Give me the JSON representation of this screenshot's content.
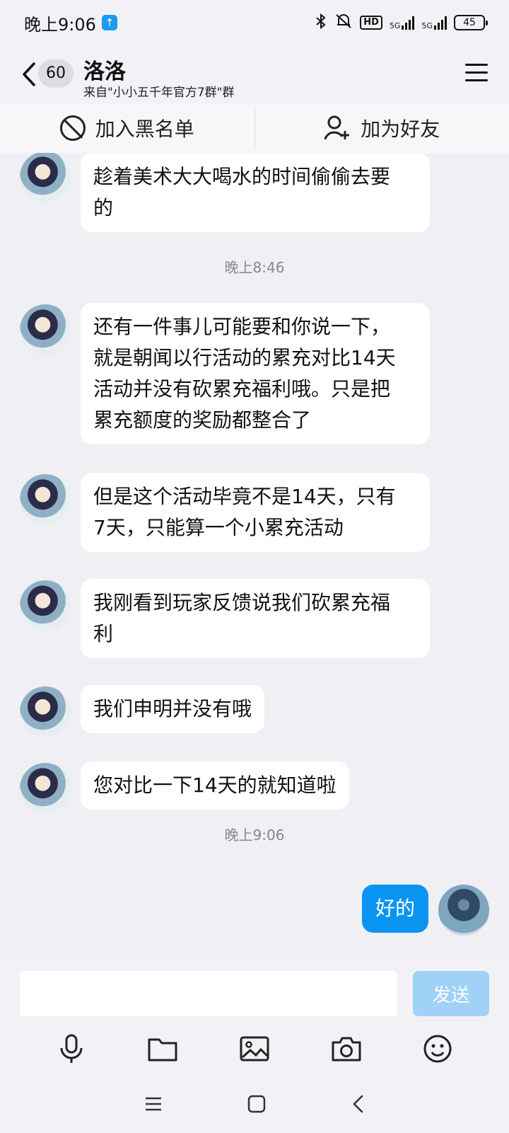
{
  "status_bar": {
    "time": "晚上9:06",
    "network_label_1": "5G",
    "network_label_2": "5G",
    "hd": "HD",
    "battery": "45"
  },
  "header": {
    "unread_count": "60",
    "contact_name": "洛洛",
    "source": "来自\"小小五千年官方7群\"群"
  },
  "actions": {
    "block_label": "加入黑名单",
    "add_friend_label": "加为好友"
  },
  "messages": [
    {
      "type": "in",
      "text_lines": [
        "趁着美术大大喝水的时间偷偷去要",
        "的"
      ]
    },
    {
      "type": "time",
      "text": "晚上8:46"
    },
    {
      "type": "in",
      "text_lines": [
        "还有一件事儿可能要和你说一下，",
        "就是朝闻以行活动的累充对比14天",
        "活动并没有砍累充福利哦。只是把",
        "累充额度的奖励都整合了"
      ]
    },
    {
      "type": "in",
      "text_lines": [
        "但是这个活动毕竟不是14天，只有",
        "7天，只能算一个小累充活动"
      ]
    },
    {
      "type": "in",
      "text_lines": [
        "我刚看到玩家反馈说我们砍累充福",
        "利"
      ]
    },
    {
      "type": "in",
      "text_lines": [
        "我们申明并没有哦"
      ]
    },
    {
      "type": "in",
      "text_lines": [
        "您对比一下14天的就知道啦"
      ]
    },
    {
      "type": "time",
      "text": "晚上9:06"
    },
    {
      "type": "out",
      "text_lines": [
        "好的"
      ]
    }
  ],
  "composer": {
    "input_value": "",
    "send_label": "发送"
  },
  "toolbar_icons": [
    "microphone-icon",
    "folder-icon",
    "image-icon",
    "camera-icon",
    "emoji-icon"
  ],
  "colors": {
    "accent": "#0a94f2",
    "send_disabled": "#9fd2f6",
    "background": "#efeff4"
  }
}
